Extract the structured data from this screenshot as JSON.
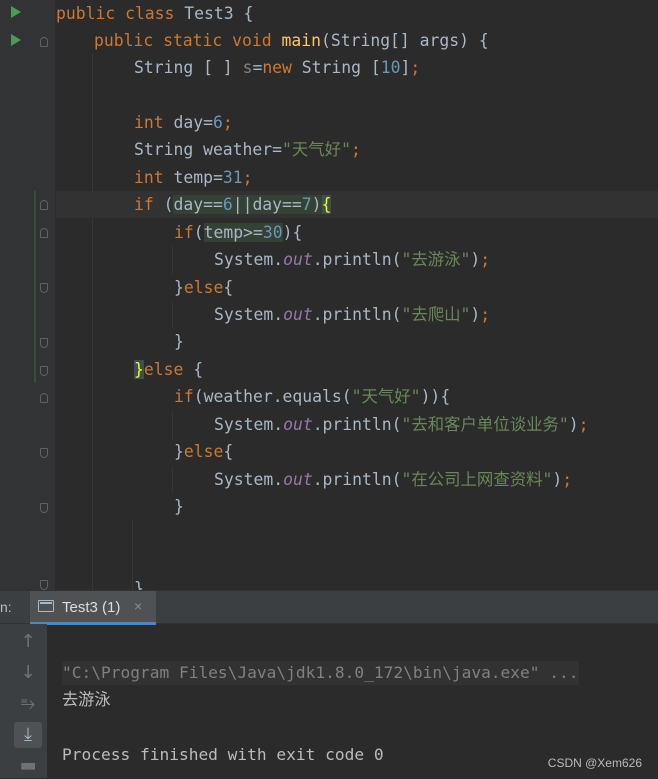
{
  "editor": {
    "lines": [
      {
        "tokens": [
          [
            "kw",
            "public class "
          ],
          [
            "",
            "Test3 {"
          ]
        ]
      },
      {
        "tokens": [
          [
            "kw",
            "public static void "
          ],
          [
            "fn",
            "main"
          ],
          [
            "",
            "(String[] args) {"
          ]
        ]
      },
      {
        "tokens": [
          [
            "",
            "String [ ] "
          ],
          [
            "unused",
            "s"
          ],
          [
            "",
            "="
          ],
          [
            "kw",
            "new "
          ],
          [
            "",
            "String ["
          ],
          [
            "num",
            "10"
          ],
          [
            "",
            "]"
          ],
          [
            "kw",
            ";"
          ]
        ]
      },
      {
        "tokens": []
      },
      {
        "tokens": [
          [
            "kw",
            "int "
          ],
          [
            "",
            "day="
          ],
          [
            "num",
            "6"
          ],
          [
            "kw",
            ";"
          ]
        ]
      },
      {
        "tokens": [
          [
            "",
            "String weather="
          ],
          [
            "str",
            "\"天气好\""
          ],
          [
            "kw",
            ";"
          ]
        ]
      },
      {
        "tokens": [
          [
            "kw",
            "int "
          ],
          [
            "",
            "temp="
          ],
          [
            "num",
            "31"
          ],
          [
            "kw",
            ";"
          ]
        ]
      },
      {
        "tokens": [
          [
            "kw",
            "if "
          ],
          [
            "",
            "("
          ],
          [
            "hl",
            "day=="
          ],
          [
            "hlnum",
            "6"
          ],
          [
            "hl",
            "||day=="
          ],
          [
            "hlnum",
            "7"
          ],
          [
            "hl",
            ")"
          ],
          [
            "bracehl",
            "{"
          ]
        ]
      },
      {
        "tokens": [
          [
            "kw",
            "if"
          ],
          [
            "",
            "("
          ],
          [
            "hl",
            "temp>="
          ],
          [
            "hlnum",
            "30"
          ],
          [
            "",
            "){"
          ]
        ]
      },
      {
        "tokens": [
          [
            "",
            "System."
          ],
          [
            "fld",
            "out"
          ],
          [
            "",
            ".println("
          ],
          [
            "str",
            "\"去游泳\""
          ],
          [
            "",
            ")"
          ],
          [
            "kw",
            ";"
          ]
        ]
      },
      {
        "tokens": [
          [
            "",
            "}"
          ],
          [
            "kw",
            "else"
          ],
          [
            "",
            "{"
          ]
        ]
      },
      {
        "tokens": [
          [
            "",
            "System."
          ],
          [
            "fld",
            "out"
          ],
          [
            "",
            ".println("
          ],
          [
            "str",
            "\"去爬山\""
          ],
          [
            "",
            ")"
          ],
          [
            "kw",
            ";"
          ]
        ]
      },
      {
        "tokens": [
          [
            "",
            "}"
          ]
        ]
      },
      {
        "tokens": [
          [
            "bracehl",
            "}"
          ],
          [
            "kw",
            "else "
          ],
          [
            "",
            "{"
          ]
        ]
      },
      {
        "tokens": [
          [
            "kw",
            "if"
          ],
          [
            "",
            "(weather.equals("
          ],
          [
            "str",
            "\"天气好\""
          ],
          [
            "",
            "))"
          ],
          [
            "",
            "{"
          ]
        ]
      },
      {
        "tokens": [
          [
            "",
            "System."
          ],
          [
            "fld",
            "out"
          ],
          [
            "",
            ".println("
          ],
          [
            "str",
            "\"去和客户单位谈业务\""
          ],
          [
            "",
            ")"
          ],
          [
            "kw",
            ";"
          ]
        ]
      },
      {
        "tokens": [
          [
            "",
            "}"
          ],
          [
            "kw",
            "else"
          ],
          [
            "",
            "{"
          ]
        ]
      },
      {
        "tokens": [
          [
            "",
            "System."
          ],
          [
            "fld",
            "out"
          ],
          [
            "",
            ".println("
          ],
          [
            "str",
            "\"在公司上网查资料\""
          ],
          [
            "",
            ")"
          ],
          [
            "kw",
            ";"
          ]
        ]
      },
      {
        "tokens": [
          [
            "",
            "}"
          ]
        ]
      },
      {
        "tokens": []
      },
      {
        "tokens": []
      },
      {
        "tokens": [
          [
            "",
            "}"
          ]
        ]
      }
    ]
  },
  "tool_window": {
    "run_label": "n:",
    "tab_label": "Test3 (1)",
    "tab_close": "×",
    "console": {
      "command": "\"C:\\Program Files\\Java\\jdk1.8.0_172\\bin\\java.exe\" ...",
      "output": "去游泳",
      "exit": "Process finished with exit code 0"
    },
    "buttons": [
      "arrow-up-icon",
      "arrow-down-icon",
      "soft-wrap-icon",
      "scroll-to-end-icon",
      "print-icon"
    ]
  },
  "watermark": "CSDN @Xem626"
}
